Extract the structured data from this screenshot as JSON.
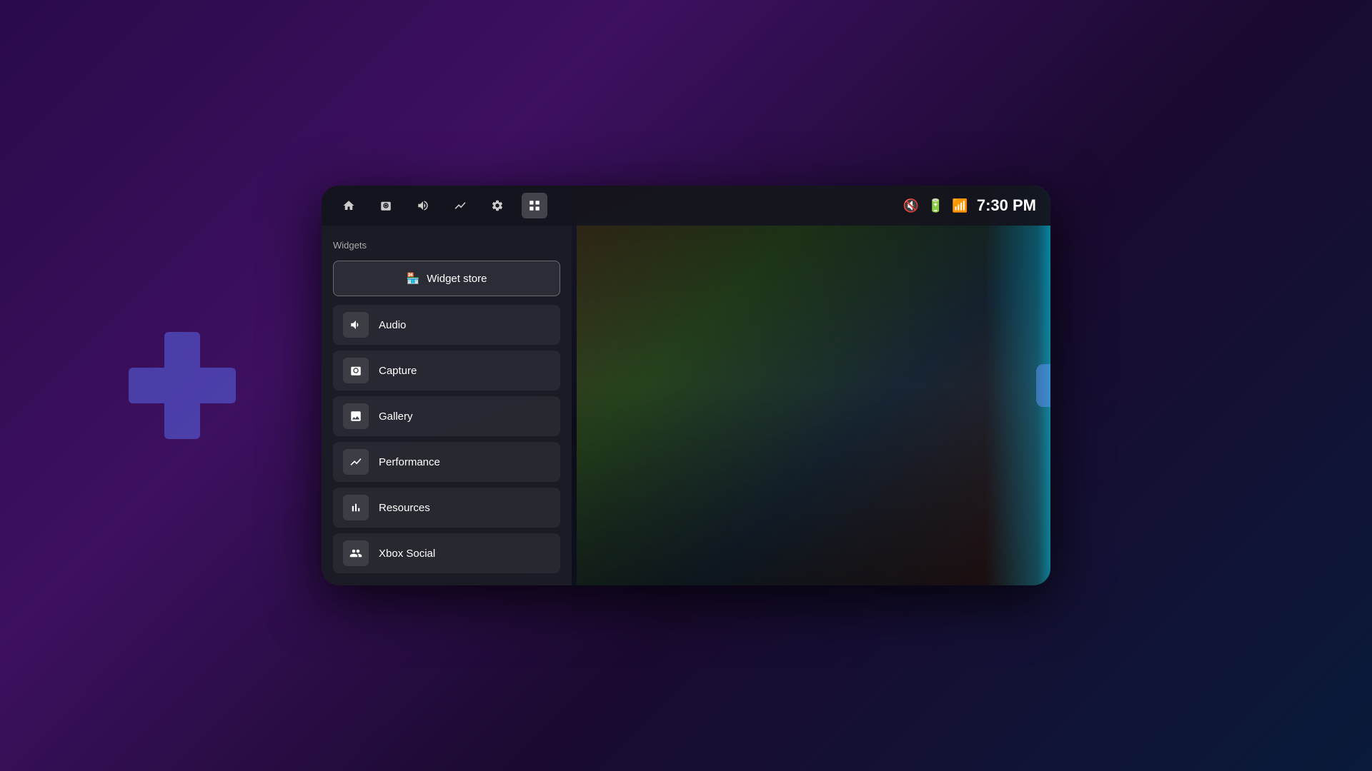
{
  "background": {
    "description": "Xbox Game Bar style overlay on gaming PC"
  },
  "navbar": {
    "time": "7:30 PM",
    "icons": [
      {
        "name": "home",
        "label": "Home",
        "active": false
      },
      {
        "name": "capture",
        "label": "Capture",
        "active": false
      },
      {
        "name": "audio",
        "label": "Audio",
        "active": false
      },
      {
        "name": "performance",
        "label": "Performance",
        "active": false
      },
      {
        "name": "settings",
        "label": "Settings",
        "active": false
      },
      {
        "name": "widgets",
        "label": "Widgets",
        "active": true
      }
    ],
    "status": {
      "mute": "Muted",
      "battery": "Battery",
      "wifi": "WiFi"
    }
  },
  "sidebar": {
    "section_label": "Widgets",
    "widget_store_label": "Widget store",
    "items": [
      {
        "id": "audio",
        "label": "Audio"
      },
      {
        "id": "capture",
        "label": "Capture"
      },
      {
        "id": "gallery",
        "label": "Gallery"
      },
      {
        "id": "performance",
        "label": "Performance"
      },
      {
        "id": "resources",
        "label": "Resources"
      },
      {
        "id": "xbox-social",
        "label": "Xbox Social"
      }
    ]
  }
}
